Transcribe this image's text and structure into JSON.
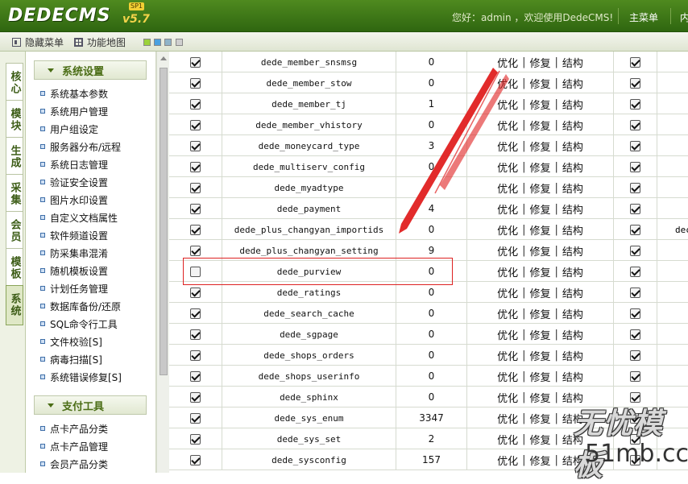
{
  "header": {
    "logo": "DEDECMS",
    "version": "v5.7",
    "sp_badge": "SP1",
    "welcome": "您好：admin ，欢迎使用DedeCMS!",
    "main_menu": "主菜单",
    "more": "内"
  },
  "toolbar": {
    "hide_menu": "隐藏菜单",
    "site_map": "功能地图",
    "swatch_colors": [
      "#9bd23a",
      "#4aa0e0",
      "#8fb3c8",
      "#cfcfcf"
    ]
  },
  "vtabs": [
    {
      "label": "核心",
      "active": false
    },
    {
      "label": "模块",
      "active": false
    },
    {
      "label": "生成",
      "active": false
    },
    {
      "label": "采集",
      "active": false
    },
    {
      "label": "会员",
      "active": false
    },
    {
      "label": "模板",
      "active": false
    },
    {
      "label": "系统",
      "active": true
    }
  ],
  "sidebar": {
    "sections": [
      {
        "title": "系统设置",
        "items": [
          "系统基本参数",
          "系统用户管理",
          "用户组设定",
          "服务器分布/远程",
          "系统日志管理",
          "验证安全设置",
          "图片水印设置",
          "自定义文档属性",
          "软件频道设置",
          "防采集串混淆",
          "随机模板设置",
          "计划任务管理",
          "数据库备份/还原",
          "SQL命令行工具",
          "文件校验[S]",
          "病毒扫描[S]",
          "系统错误修复[S]"
        ]
      },
      {
        "title": "支付工具",
        "items": [
          "点卡产品分类",
          "点卡产品管理",
          "会员产品分类"
        ]
      }
    ]
  },
  "table": {
    "ops": [
      "优化",
      "修复",
      "结构"
    ],
    "rows": [
      {
        "name": "dede_member_snsmsg",
        "count": "0",
        "checked": true,
        "extra": ""
      },
      {
        "name": "dede_member_stow",
        "count": "0",
        "checked": true,
        "extra": ""
      },
      {
        "name": "dede_member_tj",
        "count": "1",
        "checked": true,
        "extra": ""
      },
      {
        "name": "dede_member_vhistory",
        "count": "0",
        "checked": true,
        "extra": ""
      },
      {
        "name": "dede_moneycard_type",
        "count": "3",
        "checked": true,
        "extra": ""
      },
      {
        "name": "dede_multiserv_config",
        "count": "0",
        "checked": true,
        "extra": ""
      },
      {
        "name": "dede_myadtype",
        "count": "",
        "checked": true,
        "extra": ""
      },
      {
        "name": "dede_payment",
        "count": "4",
        "checked": true,
        "extra": ""
      },
      {
        "name": "dede_plus_changyan_importids",
        "count": "0",
        "checked": true,
        "extra": "dec"
      },
      {
        "name": "dede_plus_changyan_setting",
        "count": "9",
        "checked": true,
        "extra": ""
      },
      {
        "name": "dede_purview",
        "count": "0",
        "checked": false,
        "extra": ""
      },
      {
        "name": "dede_ratings",
        "count": "0",
        "checked": true,
        "extra": ""
      },
      {
        "name": "dede_search_cache",
        "count": "0",
        "checked": true,
        "extra": ""
      },
      {
        "name": "dede_sgpage",
        "count": "0",
        "checked": true,
        "extra": ""
      },
      {
        "name": "dede_shops_orders",
        "count": "0",
        "checked": true,
        "extra": ""
      },
      {
        "name": "dede_shops_userinfo",
        "count": "0",
        "checked": true,
        "extra": ""
      },
      {
        "name": "dede_sphinx",
        "count": "0",
        "checked": true,
        "extra": ""
      },
      {
        "name": "dede_sys_enum",
        "count": "3347",
        "checked": true,
        "extra": ""
      },
      {
        "name": "dede_sys_set",
        "count": "2",
        "checked": true,
        "extra": ""
      },
      {
        "name": "dede_sysconfig",
        "count": "157",
        "checked": true,
        "extra": ""
      }
    ]
  },
  "watermark": {
    "line1": "无忧模板",
    "line2": "51mb.cc"
  },
  "colors": {
    "header_green": "#3a7516",
    "annotation_red": "#dd2222"
  }
}
